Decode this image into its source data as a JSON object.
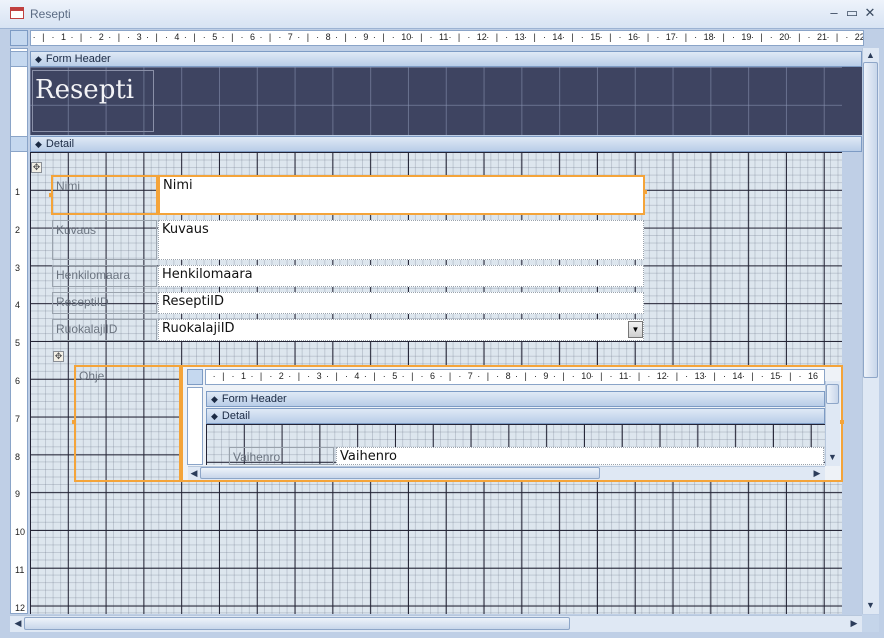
{
  "window": {
    "title": "Resepti",
    "buttons": {
      "minimize": "–",
      "restore": "▭",
      "close": "✕"
    }
  },
  "ruler": {
    "h_numbers": [
      "1",
      "2",
      "3",
      "4",
      "5",
      "6",
      "7",
      "8",
      "9",
      "10",
      "11",
      "12",
      "13",
      "14",
      "15",
      "16",
      "17",
      "18",
      "19",
      "20",
      "21",
      "22"
    ],
    "v_numbers": [
      "1",
      "2",
      "3",
      "4",
      "5",
      "6",
      "7",
      "8",
      "9",
      "10",
      "11",
      "12"
    ]
  },
  "sections": {
    "form_header": "Form Header",
    "detail": "Detail"
  },
  "form_title": "Resepti",
  "fields": [
    {
      "label": "Nimi",
      "control": "Nimi",
      "selected": true
    },
    {
      "label": "Kuvaus",
      "control": "Kuvaus"
    },
    {
      "label": "Henkilomaara",
      "control": "Henkilomaara"
    },
    {
      "label": "ReseptiID",
      "control": "ReseptiID"
    },
    {
      "label": "RuokalajiID",
      "control": "RuokalajiID",
      "type": "combo"
    }
  ],
  "subform": {
    "label": "Ohje",
    "ruler_numbers": [
      "1",
      "2",
      "3",
      "4",
      "5",
      "6",
      "7",
      "8",
      "9",
      "10",
      "11",
      "12",
      "13",
      "14",
      "15",
      "16"
    ],
    "sections": {
      "form_header": "Form Header",
      "detail": "Detail"
    },
    "field": {
      "label": "Vaihenro",
      "control": "Vaihenro"
    }
  },
  "colors": {
    "selection": "#f4a43a",
    "header_bg": "#3e4461",
    "detail_bg": "#dde6ee"
  }
}
